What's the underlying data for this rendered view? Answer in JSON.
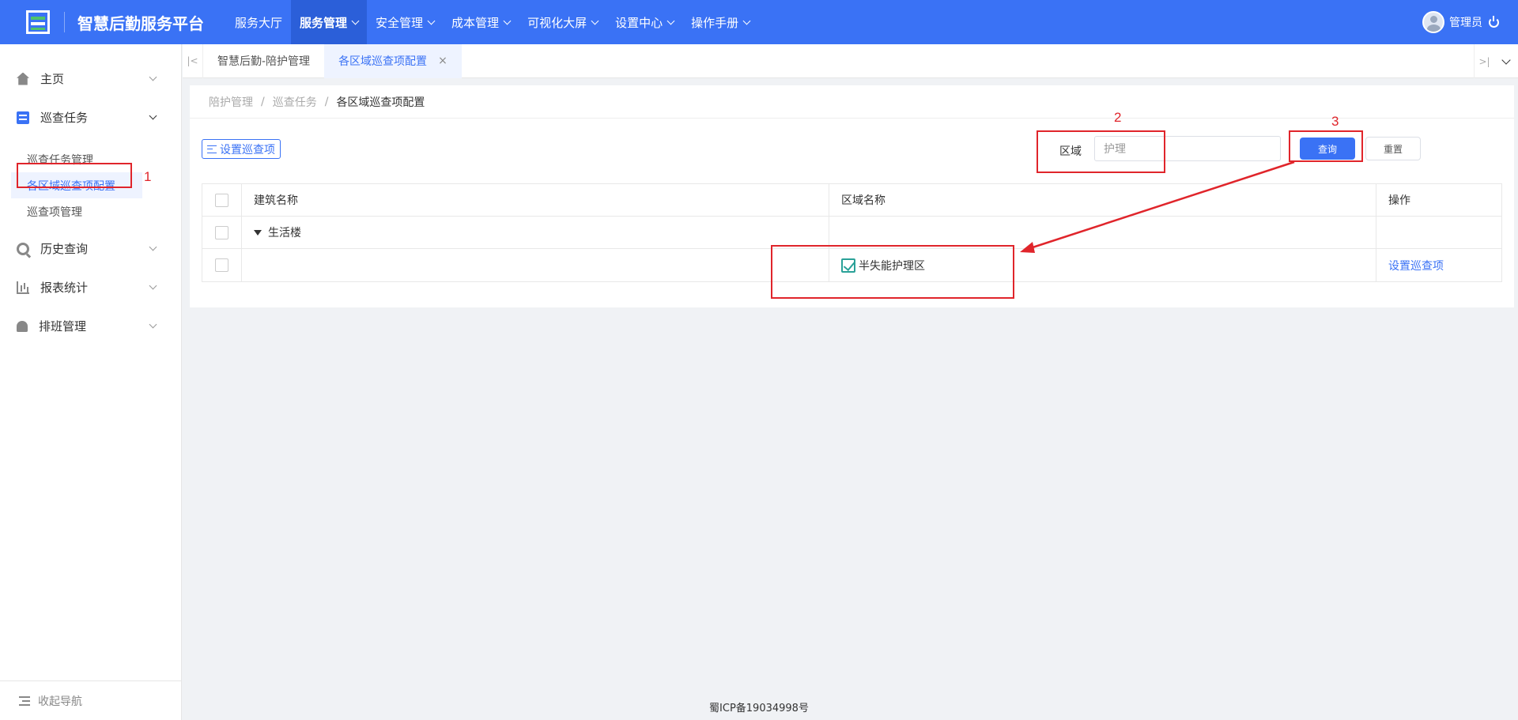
{
  "header": {
    "title": "智慧后勤服务平台",
    "nav": [
      {
        "label": "服务大厅",
        "has_dropdown": false,
        "active": false
      },
      {
        "label": "服务管理",
        "has_dropdown": true,
        "active": true
      },
      {
        "label": "安全管理",
        "has_dropdown": true,
        "active": false
      },
      {
        "label": "成本管理",
        "has_dropdown": true,
        "active": false
      },
      {
        "label": "可视化大屏",
        "has_dropdown": true,
        "active": false
      },
      {
        "label": "设置中心",
        "has_dropdown": true,
        "active": false
      },
      {
        "label": "操作手册",
        "has_dropdown": true,
        "active": false
      }
    ],
    "user": "管理员",
    "accent": "#3a72f5"
  },
  "sidebar": {
    "groups": [
      {
        "label": "主页",
        "icon": "home-icon"
      },
      {
        "label": "巡查任务",
        "icon": "task-icon",
        "children": [
          "巡查任务管理",
          "各区域巡查项配置",
          "巡查项管理"
        ]
      },
      {
        "label": "历史查询",
        "icon": "history-icon"
      },
      {
        "label": "报表统计",
        "icon": "stats-icon"
      },
      {
        "label": "排班管理",
        "icon": "bell-icon"
      }
    ],
    "collapse_label": "收起导航"
  },
  "tabs": [
    {
      "label": "智慧后勤-陪护管理",
      "active": false
    },
    {
      "label": "各区域巡查项配置",
      "active": true,
      "close": "×"
    }
  ],
  "breadcrumb": [
    "陪护管理",
    "巡查任务",
    "各区域巡查项配置"
  ],
  "breadcrumb_sep": "/",
  "toolbar": {
    "set_button": "设置巡查项",
    "filter_label": "区域",
    "filter_value": "护理",
    "query_button": "查询",
    "reset_button": "重置"
  },
  "table": {
    "headers": [
      "建筑名称",
      "区域名称",
      "操作"
    ],
    "rows": [
      {
        "building": "生活楼",
        "area": "",
        "action": ""
      },
      {
        "building": "",
        "area": "半失能护理区",
        "action": "设置巡查项"
      }
    ]
  },
  "footer": "蜀ICP备19034998号",
  "annotations": [
    "1",
    "2",
    "3"
  ]
}
